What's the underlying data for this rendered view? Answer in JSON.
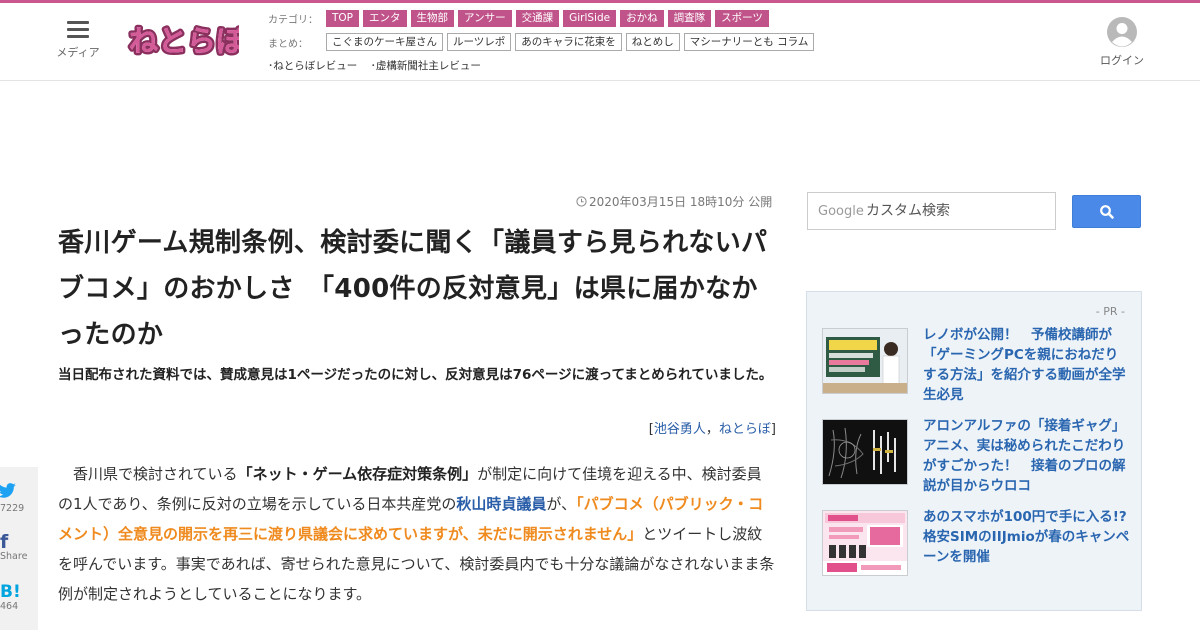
{
  "header": {
    "menu_label": "メディア",
    "logo_text": "ねとらぼ",
    "category_label": "カテゴリ：",
    "categories": [
      "TOP",
      "エンタ",
      "生物部",
      "アンサー",
      "交通課",
      "GirlSide",
      "おかね",
      "調査隊",
      "スポーツ"
    ],
    "matome_label": "まとめ：",
    "matome": [
      "こぐまのケーキ屋さん",
      "ルーツレポ",
      "あのキャラに花束を",
      "ねとめし",
      "マシーナリーとも コラム"
    ],
    "reviews": [
      "･ねとらぼレビュー",
      "･虚構新聞社主レビュー"
    ],
    "login_label": "ログイン"
  },
  "article": {
    "date": "2020年03月15日 18時10分 公開",
    "title": "香川ゲーム規制条例、検討委に聞く「議員すら見られないパブコメ」のおかしさ　「400件の反対意見」は県に届かなかったのか",
    "lead": "当日配布された資料では、賛成意見は1ページだったのに対し、反対意見は76ページに渡ってまとめられていました。",
    "byline_open": "[",
    "author": "池谷勇人",
    "byline_sep": "，",
    "publisher": "ねとらぼ",
    "byline_close": "]",
    "body": {
      "p1": "香川県で検討されている",
      "p2": "「ネット・ゲーム依存症対策条例」",
      "p3": "が制定に向けて佳境を迎える中、検討委員の1人であり、条例に反対の立場を示している日本共産党の",
      "p4": "秋山時貞議員",
      "p5": "が、",
      "p6": "「パブコメ（パブリック・コメント）全意見の開示を再三に渡り県議会に求めていますが、未だに開示されません」",
      "p7": "とツイートし波紋を呼んでいます。事実であれば、寄せられた意見について、検討委員内でも十分な議論がなされないまま条例が制定されようとしていることになります。"
    }
  },
  "share": {
    "twitter_count": "7229",
    "facebook_label": "Share",
    "hatena_count": "464"
  },
  "search": {
    "google_label": "Google",
    "placeholder": "カスタム検索"
  },
  "pr": {
    "label": "- PR -",
    "items": [
      {
        "title": "レノボが公開！　予備校講師が「ゲーミングPCを親におねだりする方法」を紹介する動画が全学生必見"
      },
      {
        "title": "アロンアルファの「接着ギャグ」アニメ、実は秘められたこだわりがすごかった！　接着のプロの解説が目からウロコ"
      },
      {
        "title": "あのスマホが100円で手に入る!?　格安SIMのIIJmioが春のキャンペーンを開催"
      }
    ]
  },
  "colors": {
    "brand_pink": "#c0548a",
    "link_blue": "#2a5ea8",
    "highlight_orange": "#ef8a1e",
    "search_blue": "#4a89e8"
  }
}
